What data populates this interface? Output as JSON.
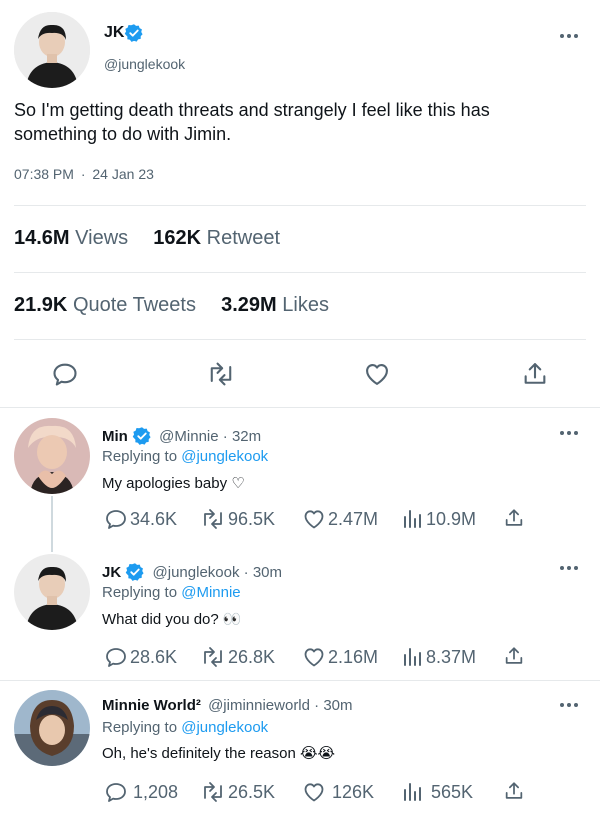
{
  "main_tweet": {
    "author_name": "JK",
    "author_handle": "@junglekook",
    "text": "So I'm getting death threats and strangely I feel like this has something to do with Jimin.",
    "time": "07:38 PM",
    "separator": "·",
    "date": "24 Jan 23",
    "stats": {
      "views_count": "14.6M",
      "views_label": "Views",
      "retweets_count": "162K",
      "retweets_label": "Retweet",
      "quotes_count": "21.9K",
      "quotes_label": "Quote Tweets",
      "likes_count": "3.29M",
      "likes_label": "Likes"
    }
  },
  "replies": [
    {
      "author_name": "Min",
      "author_handle": "@Minnie",
      "time_ago": "32m",
      "replying_prefix": "Replying to",
      "replying_to": "@junglekook",
      "text": "My apologies baby ♡",
      "replies": "34.6K",
      "retweets": "96.5K",
      "likes": "2.47M",
      "views": "10.9M"
    },
    {
      "author_name": "JK",
      "author_handle": "@junglekook",
      "time_ago": "30m",
      "replying_prefix": "Replying to",
      "replying_to": "@Minnie",
      "text": "What did you do? 👀",
      "replies": "28.6K",
      "retweets": "26.8K",
      "likes": "2.16M",
      "views": "8.37M"
    },
    {
      "author_name": "Minnie World²",
      "author_handle": "@jiminnieworld",
      "time_ago": "30m",
      "replying_prefix": "Replying to",
      "replying_to": "@junglekook",
      "text": "Oh, he's definitely the reason 😭😭",
      "replies": "1,208",
      "retweets": "26.5K",
      "likes": "126K",
      "views": "565K"
    }
  ],
  "colors": {
    "accent": "#1d9bf0",
    "muted": "#536471",
    "text": "#0f1419",
    "divider": "#e6e9eb"
  },
  "icons": [
    "verified-badge-icon",
    "more-icon",
    "reply-icon",
    "retweet-icon",
    "like-icon",
    "views-icon",
    "share-icon"
  ]
}
